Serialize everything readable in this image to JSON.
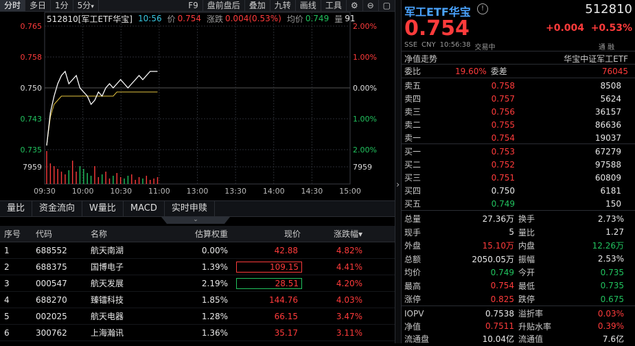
{
  "toolbar": {
    "tabs": [
      "分时",
      "多日",
      "1分",
      "5分"
    ],
    "actions": [
      "F9",
      "盘前盘后",
      "叠加",
      "九转",
      "画线",
      "工具"
    ],
    "five_dropdown": "▾"
  },
  "info": {
    "code": "512810[军工ETF华宝]",
    "time": "10:56",
    "price_label": "价",
    "price": "0.754",
    "change_label": "涨跌",
    "change": "0.004(0.53%)",
    "avg_label": "均价",
    "avg": "0.749",
    "vol_label": "量",
    "vol": "91"
  },
  "chart_data": {
    "type": "line",
    "x_ticks": [
      "09:30",
      "10:00",
      "10:30",
      "11:00",
      "13:00",
      "13:30",
      "14:00",
      "14:30",
      "15:00"
    ],
    "y_left_ticks": [
      "0.765",
      "0.758",
      "0.750",
      "0.743",
      "0.735"
    ],
    "y_right_ticks": [
      "2.00%",
      "1.00%",
      "0.00%",
      "1.00%",
      "2.00%"
    ],
    "vol_label": "7959",
    "prev_close": 0.75,
    "ylim": [
      0.735,
      0.765
    ],
    "price": [
      0.736,
      0.744,
      0.748,
      0.751,
      0.753,
      0.754,
      0.751,
      0.752,
      0.753,
      0.75,
      0.749,
      0.748,
      0.746,
      0.747,
      0.749,
      0.748,
      0.75,
      0.751,
      0.75,
      0.751,
      0.752,
      0.751,
      0.75,
      0.751,
      0.752,
      0.753,
      0.752,
      0.753,
      0.754,
      0.754,
      0.754
    ],
    "avg": [
      0.736,
      0.743,
      0.746,
      0.747,
      0.748,
      0.748,
      0.748,
      0.748,
      0.748,
      0.748,
      0.748,
      0.748,
      0.748,
      0.748,
      0.748,
      0.748,
      0.748,
      0.748,
      0.748,
      0.749,
      0.749,
      0.749,
      0.749,
      0.749,
      0.749,
      0.749,
      0.749,
      0.749,
      0.749,
      0.749,
      0.749
    ]
  },
  "subtabs": [
    "量比",
    "资金流向",
    "W量比",
    "MACD",
    "实时申赎"
  ],
  "table": {
    "headers": [
      "序号",
      "代码",
      "名称",
      "估算权重",
      "现价",
      "涨跌幅▾"
    ],
    "rows": [
      {
        "n": "1",
        "code": "688552",
        "name": "航天南湖",
        "w": "0.00%",
        "price": "42.88",
        "pct": "4.82%",
        "box": ""
      },
      {
        "n": "2",
        "code": "688375",
        "name": "国博电子",
        "w": "1.39%",
        "price": "109.15",
        "pct": "4.41%",
        "box": "red"
      },
      {
        "n": "3",
        "code": "000547",
        "name": "航天发展",
        "w": "2.19%",
        "price": "28.51",
        "pct": "4.20%",
        "box": "green"
      },
      {
        "n": "4",
        "code": "688270",
        "name": "臻镭科技",
        "w": "1.85%",
        "price": "144.76",
        "pct": "4.03%",
        "box": ""
      },
      {
        "n": "5",
        "code": "002025",
        "name": "航天电器",
        "w": "1.28%",
        "price": "66.15",
        "pct": "3.47%",
        "box": ""
      },
      {
        "n": "6",
        "code": "300762",
        "name": "上海瀚讯",
        "w": "1.36%",
        "price": "35.17",
        "pct": "3.11%",
        "box": ""
      }
    ]
  },
  "side": {
    "arrow": "›"
  },
  "quote": {
    "name": "军工ETF华宝",
    "code": "512810",
    "price": "0.754",
    "chg": "+0.004",
    "pct": "+0.53%",
    "market": "SSE",
    "currency": "CNY",
    "time": "10:56:38",
    "status": "交易中",
    "tags": "通 融",
    "nav_label": "净值走势",
    "index_name": "华宝中证军工ETF",
    "weibi_label": "委比",
    "weibi": "19.60%",
    "weicha_label": "委差",
    "weicha": "76045",
    "asks": [
      {
        "l": "卖五",
        "p": "0.758",
        "v": "8508"
      },
      {
        "l": "卖四",
        "p": "0.757",
        "v": "5624"
      },
      {
        "l": "卖三",
        "p": "0.756",
        "v": "36157"
      },
      {
        "l": "卖二",
        "p": "0.755",
        "v": "86636"
      },
      {
        "l": "卖一",
        "p": "0.754",
        "v": "19037"
      }
    ],
    "bids": [
      {
        "l": "买一",
        "p": "0.753",
        "v": "67279"
      },
      {
        "l": "买二",
        "p": "0.752",
        "v": "97588"
      },
      {
        "l": "买三",
        "p": "0.751",
        "v": "60809"
      },
      {
        "l": "买四",
        "p": "0.750",
        "v": "6181"
      },
      {
        "l": "买五",
        "p": "0.749",
        "v": "150"
      }
    ],
    "stats": [
      {
        "k1": "总量",
        "v1": "27.36万",
        "k2": "换手",
        "v2": "2.73%"
      },
      {
        "k1": "现手",
        "v1": "5",
        "k2": "量比",
        "v2": "1.27"
      },
      {
        "k1": "外盘",
        "v1": "15.10万",
        "k2": "内盘",
        "v2": "12.26万"
      },
      {
        "k1": "总额",
        "v1": "2050.05万",
        "k2": "振幅",
        "v2": "2.53%"
      },
      {
        "k1": "均价",
        "v1": "0.749",
        "k2": "今开",
        "v2": "0.735"
      },
      {
        "k1": "最高",
        "v1": "0.754",
        "k2": "最低",
        "v2": "0.735"
      },
      {
        "k1": "涨停",
        "v1": "0.825",
        "k2": "跌停",
        "v2": "0.675"
      }
    ],
    "stats2": [
      {
        "k1": "IOPV",
        "v1": "0.7538",
        "k2": "溢折率",
        "v2": "0.03%"
      },
      {
        "k1": "净值",
        "v1": "0.7511",
        "k2": "升贴水率",
        "v2": "0.39%"
      },
      {
        "k1": "流通盘",
        "v1": "10.04亿",
        "k2": "流通值",
        "v2": "7.6亿"
      }
    ]
  }
}
